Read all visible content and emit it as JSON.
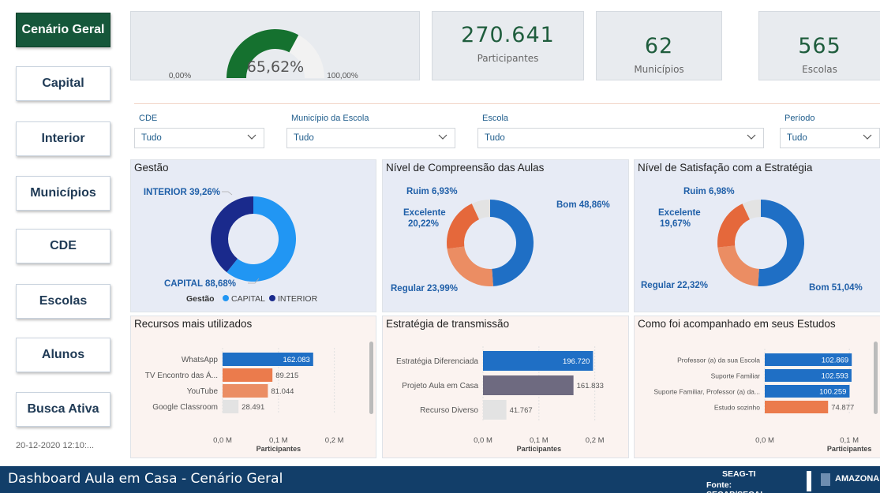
{
  "nav": {
    "items": [
      {
        "label": "Cenário Geral",
        "active": true
      },
      {
        "label": "Capital",
        "active": false
      },
      {
        "label": "Interior",
        "active": false
      },
      {
        "label": "Municípios",
        "active": false
      },
      {
        "label": "CDE",
        "active": false
      },
      {
        "label": "Escolas",
        "active": false
      },
      {
        "label": "Alunos",
        "active": false
      },
      {
        "label": "Busca Ativa",
        "active": false
      }
    ],
    "timestamp": "20-12-2020 12:10:..."
  },
  "gauge": {
    "value": 65.62,
    "value_label": "65,62%",
    "min_label": "0,00%",
    "max_label": "100,00%",
    "color": "#15712f"
  },
  "kpis": [
    {
      "value": "270.641",
      "label": "Participantes"
    },
    {
      "value": "62",
      "label": "Municípios"
    },
    {
      "value": "565",
      "label": "Escolas"
    }
  ],
  "filters": [
    {
      "label": "CDE",
      "value": "Tudo"
    },
    {
      "label": "Município da Escola",
      "value": "Tudo"
    },
    {
      "label": "Escola",
      "value": "Tudo"
    },
    {
      "label": "Período",
      "value": "Tudo"
    }
  ],
  "panels": {
    "gestao": {
      "title": "Gestão",
      "legend_title": "Gestão",
      "legend": [
        "CAPITAL",
        "INTERIOR"
      ]
    },
    "compreensao": {
      "title": "Nível de Compreensão das Aulas"
    },
    "satisfacao": {
      "title": "Nível de Satisfação com a Estratégia"
    },
    "recursos": {
      "title": "Recursos mais utilizados"
    },
    "estrategia": {
      "title": "Estratégia de transmissão"
    },
    "acompanhamento": {
      "title": "Como foi acompanhado em seus Estudos"
    }
  },
  "chart_data": [
    {
      "type": "pie",
      "title": "Gestão",
      "slices": [
        {
          "name": "CAPITAL",
          "label": "CAPITAL 88,68%",
          "value": 60.74,
          "color": "#2196f3"
        },
        {
          "name": "INTERIOR",
          "label": "INTERIOR 39,26%",
          "value": 39.26,
          "color": "#1a2a8c"
        }
      ]
    },
    {
      "type": "pie",
      "title": "Nível de Compreensão das Aulas",
      "slices": [
        {
          "name": "Bom",
          "label": "Bom 48,86%",
          "value": 48.86,
          "color": "#1f6fc5"
        },
        {
          "name": "Regular",
          "label": "Regular 23,99%",
          "value": 23.99,
          "color": "#eb8d63"
        },
        {
          "name": "Excelente",
          "label": "Excelente 20,22%",
          "value": 20.22,
          "color": "#e5683b"
        },
        {
          "name": "Ruim",
          "label": "Ruim 6,93%",
          "value": 6.93,
          "color": "#e3e3e3"
        }
      ]
    },
    {
      "type": "pie",
      "title": "Nível de Satisfação com a Estratégia",
      "slices": [
        {
          "name": "Bom",
          "label": "Bom 51,04%",
          "value": 51.04,
          "color": "#1f6fc5"
        },
        {
          "name": "Regular",
          "label": "Regular 22,32%",
          "value": 22.32,
          "color": "#eb8d63"
        },
        {
          "name": "Excelente",
          "label": "Excelente 19,67%",
          "value": 19.67,
          "color": "#e5683b"
        },
        {
          "name": "Ruim",
          "label": "Ruim 6,98%",
          "value": 6.98,
          "color": "#e3e3e3"
        }
      ]
    },
    {
      "type": "bar",
      "title": "Recursos mais utilizados",
      "xlabel": "Participantes",
      "xlim": [
        0,
        240000
      ],
      "ticks": [
        "0,0 M",
        "0,1 M",
        "0,2 M"
      ],
      "categories": [
        "WhatsApp",
        "TV Encontro das Á...",
        "YouTube",
        "Google Classroom"
      ],
      "values": [
        162083,
        89215,
        81044,
        28491
      ],
      "value_labels": [
        "162.083",
        "89.215",
        "81.044",
        "28.491"
      ],
      "colors": [
        "#1f6fc5",
        "#eb7b4c",
        "#eb8d63",
        "#e3e3e3"
      ]
    },
    {
      "type": "bar",
      "title": "Estratégia de transmissão",
      "xlabel": "Participantes",
      "xlim": [
        0,
        240000
      ],
      "ticks": [
        "0,0 M",
        "0,1 M",
        "0,2 M"
      ],
      "categories": [
        "Estratégia Diferenciada",
        "Projeto Aula em Casa",
        "Recurso Diverso"
      ],
      "values": [
        196720,
        161833,
        41767
      ],
      "value_labels": [
        "196.720",
        "161.833",
        "41.767"
      ],
      "colors": [
        "#1f6fc5",
        "#6e6a80",
        "#e3e3e3"
      ]
    },
    {
      "type": "bar",
      "title": "Como foi acompanhado em seus Estudos",
      "xlabel": "Participantes",
      "xlim": [
        0,
        140000
      ],
      "ticks": [
        "0,0 M",
        "0,1 M"
      ],
      "categories": [
        "Professor (a) da sua Escola",
        "Suporte Familiar",
        "Suporte Familiar, Professor (a) da...",
        "Estudo sozinho"
      ],
      "values": [
        102869,
        102593,
        100259,
        74877
      ],
      "value_labels": [
        "102.869",
        "102.593",
        "100.259",
        "74.877"
      ],
      "colors": [
        "#1f6fc5",
        "#1f6fc5",
        "#1f6fc5",
        "#eb7b4c"
      ]
    }
  ],
  "footer": {
    "title": "Dashboard Aula em Casa - Cenário Geral",
    "org": "SEAG-TI",
    "source": "Fonte: SECAP/SECAL",
    "logo_text": "AMAZONA"
  }
}
